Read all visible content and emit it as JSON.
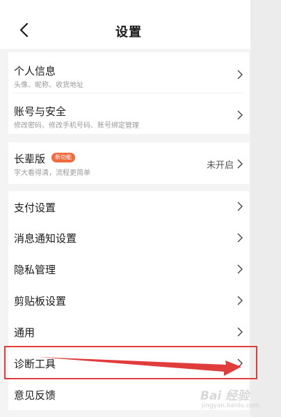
{
  "header": {
    "title": "设置",
    "back_icon": "chevron-left-icon"
  },
  "groups": [
    {
      "items": [
        {
          "label": "个人信息",
          "sub": "头像、昵称、收货地址"
        },
        {
          "label": "账号与安全",
          "sub": "修改密码、修改手机号码、账号绑定管理"
        }
      ]
    },
    {
      "items": [
        {
          "label": "长辈版",
          "badge": "新功能",
          "sub": "字大看得清，流程更简单",
          "status": "未开启"
        }
      ]
    },
    {
      "items": [
        {
          "label": "支付设置"
        },
        {
          "label": "消息通知设置"
        },
        {
          "label": "隐私管理"
        },
        {
          "label": "剪贴板设置"
        },
        {
          "label": "通用"
        },
        {
          "label": "诊断工具"
        },
        {
          "label": "意见反馈"
        }
      ]
    }
  ],
  "colors": {
    "badge": "#f26a3d",
    "annotation": "#e03c3c"
  },
  "watermark": {
    "text": "Bai 经验",
    "url": "jingyan.baidu.com"
  }
}
